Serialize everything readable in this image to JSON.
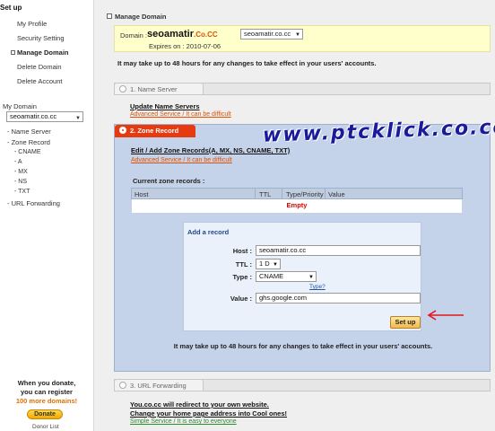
{
  "sidebar": {
    "setup_label": "Set up",
    "links": [
      {
        "label": "My Profile"
      },
      {
        "label": "Security Setting"
      },
      {
        "label": "Manage Domain"
      },
      {
        "label": "Delete Domain"
      },
      {
        "label": "Delete Account"
      }
    ],
    "my_domain_label": "My Domain",
    "domain_select": "seoamatir.co.cc",
    "nav": {
      "name_server": "- Name Server",
      "zone_record": "- Zone Record",
      "sub": [
        "- CNAME",
        "- A",
        "- MX",
        "- NS",
        "- TXT"
      ],
      "url_forwarding": "- URL Forwarding"
    },
    "donate": {
      "line1": "When you donate,",
      "line2": "you can register",
      "line3": "100 more domains!",
      "button": "Donate",
      "donor_list": "Donor List"
    }
  },
  "main": {
    "title": "Manage Domain",
    "domain_label": "Domain :",
    "domain_name": "seoamatir",
    "domain_suffix": ".Co.CC",
    "domain_select": "seoamatir.co.cc",
    "expires": "Expires on : 2010-07-06",
    "notice": "It may take up to 48 hours for any changes to take effect in your users' accounts."
  },
  "step1": {
    "label": "1. Name Server",
    "link": "Update Name Servers",
    "advanced": "Advanced Service / It can be difficult"
  },
  "step2": {
    "label": "2. Zone Record",
    "link": "Edit / Add Zone Records(A, MX, NS, CNAME, TXT)",
    "advanced": "Advanced Service / It can be difficult",
    "current_records": "Current zone records :",
    "columns": [
      "Host",
      "TTL",
      "Type/Priority",
      "Value"
    ],
    "empty": "Empty",
    "add": {
      "title": "Add a record",
      "host_label": "Host :",
      "host_value": "seoamatir.co.cc",
      "ttl_label": "TTL :",
      "ttl_value": "1 D",
      "type_label": "Type :",
      "type_value": "CNAME",
      "type_help": "Type?",
      "value_label": "Value :",
      "value_value": "ghs.google.com",
      "button": "Set up"
    },
    "notice": "It may take up to 48 hours for any changes to take effect in your users' accounts."
  },
  "step3": {
    "label": "3. URL Forwarding",
    "link1": "You.co.cc will redirect to your own website.",
    "link2": "Change your home page address into Cool ones!",
    "simple": "Simple Service / It is easy to everyone"
  },
  "watermark": "www.ptcklick.co.cc",
  "colors": {
    "zone_panel": "#c5d3ea",
    "active_tab": "#e63a10",
    "advanced_link": "#e05000",
    "empty_text": "#dd0000"
  }
}
